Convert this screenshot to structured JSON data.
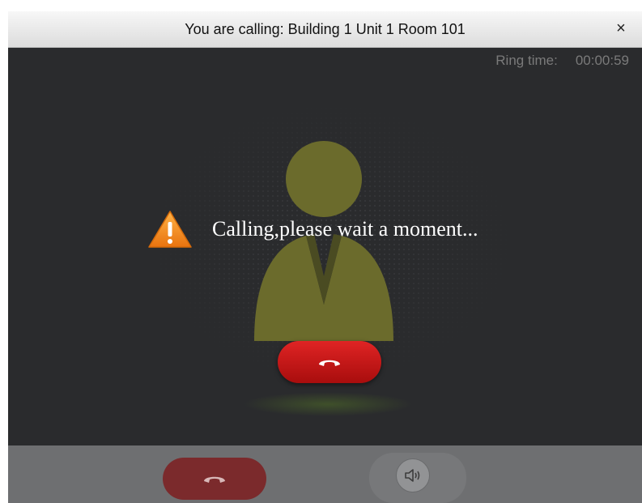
{
  "window": {
    "title": "You are calling: Building 1 Unit 1 Room 101",
    "close_glyph": "×"
  },
  "ring": {
    "label": "Ring time:",
    "value": "00:00:59"
  },
  "status": {
    "message": "Calling,please wait a moment...",
    "icon": "warning-icon"
  },
  "controls": {
    "hangup_icon": "hang-up-phone-icon",
    "speaker_icon": "speaker-icon"
  },
  "colors": {
    "background": "#2a2b2d",
    "avatar": "#6b6b2c",
    "hangup": "#c81414",
    "hangup_disabled": "#7b2a2c",
    "bottom_bar": "#6e6f71",
    "warning": "#f08a1c"
  }
}
